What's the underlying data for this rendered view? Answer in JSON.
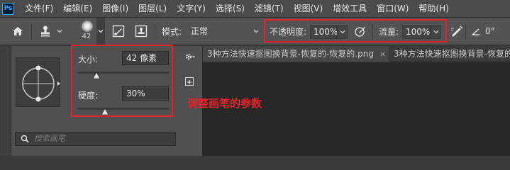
{
  "app": {
    "logo": "Ps"
  },
  "menu": [
    "文件(F)",
    "编辑(E)",
    "图像(I)",
    "图层(L)",
    "文字(Y)",
    "选择(S)",
    "滤镜(T)",
    "视图(V)",
    "增效工具",
    "窗口(W)",
    "帮助(H)"
  ],
  "options": {
    "brush_size": "42",
    "mode_label": "模式:",
    "mode_value": "正常",
    "opacity_label": "不透明度:",
    "opacity_value": "100%",
    "flow_label": "流量:",
    "flow_value": "100%",
    "angle_value": "0°"
  },
  "brush_panel": {
    "size_label": "大小:",
    "size_value": "42 像素",
    "size_fraction": 0.2,
    "hardness_label": "硬度:",
    "hardness_value": "30%",
    "hardness_fraction": 0.3,
    "search_placeholder": "搜索画笔"
  },
  "tabs": [
    {
      "title": "3种方法快速抠图换背景-恢复的-恢复的.png",
      "close": "×"
    },
    {
      "title": "3种方法快速抠图换背景-恢复的"
    }
  ],
  "annotation": "调整画笔的参数",
  "colors": {
    "highlight": "#e4222a",
    "menubar": "#4b4b4b",
    "optionsbar": "#535353",
    "panel": "#505050"
  }
}
